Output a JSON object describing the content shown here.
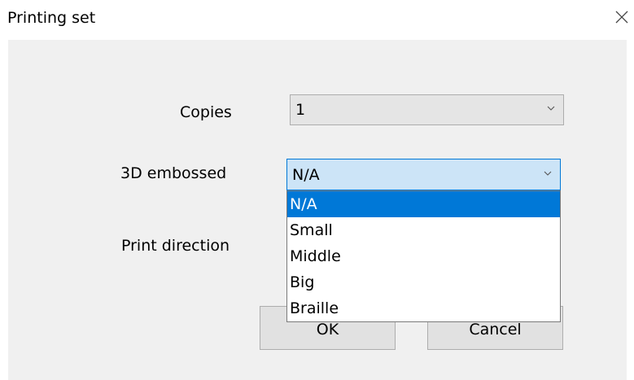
{
  "window": {
    "title": "Printing set",
    "close_icon": "close-icon"
  },
  "form": {
    "copies": {
      "label": "Copies",
      "value": "1"
    },
    "embossed": {
      "label": "3D embossed",
      "value": "N/A",
      "options": [
        "N/A",
        "Small",
        "Middle",
        "Big",
        "Braille"
      ],
      "selected_index": 0
    },
    "direction": {
      "label": "Print direction"
    }
  },
  "buttons": {
    "ok": "OK",
    "cancel": "Cancel"
  },
  "colors": {
    "accent": "#0078d7",
    "focus_fill": "#cce4f7",
    "panel": "#f0f0f0"
  }
}
